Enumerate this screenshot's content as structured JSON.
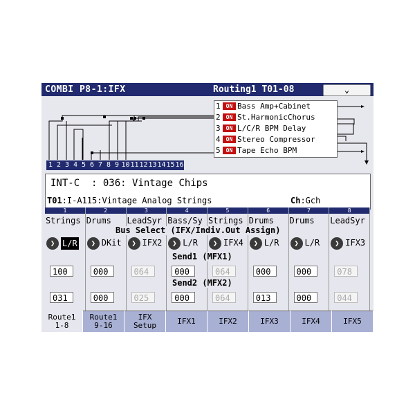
{
  "header": {
    "title": "COMBI P8-1:IFX",
    "subtitle": "Routing1 T01-08",
    "menu_icon": "chevron-down-icon",
    "menu_glyph": "⌄"
  },
  "routing": {
    "ifx": [
      {
        "num": "1",
        "state": "ON",
        "name": "Bass Amp+Cabinet"
      },
      {
        "num": "2",
        "state": "ON",
        "name": "St.HarmonicChorus"
      },
      {
        "num": "3",
        "state": "ON",
        "name": "L/C/R BPM Delay"
      },
      {
        "num": "4",
        "state": "ON",
        "name": "Stereo Compressor"
      },
      {
        "num": "5",
        "state": "ON",
        "name": "Tape Echo BPM"
      }
    ],
    "track_numbers": [
      "1",
      "2",
      "3",
      "4",
      "5",
      "6",
      "7",
      "8",
      "9",
      "10",
      "11",
      "12",
      "13",
      "14",
      "15",
      "16"
    ]
  },
  "program": {
    "bank": "INT-C",
    "name": ": 036: Vintage Chips",
    "timbre_label": "T01",
    "timbre_program": ":I-A115:Vintage Analog Strings",
    "ch_label": "Ch",
    "ch_value": ":Gch"
  },
  "timbres": [
    {
      "num": "1",
      "name": "Strings",
      "bus": "L/R",
      "send1": "100",
      "send2": "031",
      "s1_dim": false,
      "s2_dim": false,
      "selected": true
    },
    {
      "num": "2",
      "name": "Drums",
      "bus": "DKit",
      "send1": "000",
      "send2": "000",
      "s1_dim": false,
      "s2_dim": false,
      "selected": false
    },
    {
      "num": "3",
      "name": "LeadSyr",
      "bus": "IFX2",
      "send1": "064",
      "send2": "025",
      "s1_dim": true,
      "s2_dim": true,
      "selected": false
    },
    {
      "num": "4",
      "name": "Bass/Sy",
      "bus": "L/R",
      "send1": "000",
      "send2": "000",
      "s1_dim": false,
      "s2_dim": false,
      "selected": false
    },
    {
      "num": "5",
      "name": "Strings",
      "bus": "IFX4",
      "send1": "064",
      "send2": "064",
      "s1_dim": true,
      "s2_dim": true,
      "selected": false
    },
    {
      "num": "6",
      "name": "Drums",
      "bus": "L/R",
      "send1": "000",
      "send2": "013",
      "s1_dim": false,
      "s2_dim": false,
      "selected": false
    },
    {
      "num": "7",
      "name": "Drums",
      "bus": "L/R",
      "send1": "000",
      "send2": "000",
      "s1_dim": false,
      "s2_dim": false,
      "selected": false
    },
    {
      "num": "8",
      "name": "LeadSyr",
      "bus": "IFX3",
      "send1": "078",
      "send2": "044",
      "s1_dim": true,
      "s2_dim": true,
      "selected": false
    }
  ],
  "labels": {
    "bus_select": "Bus Select (IFX/Indiv.Out Assign)",
    "send1": "Send1 (MFX1)",
    "send2": "Send2 (MFX2)"
  },
  "tabs": [
    {
      "label": "Route1\n1-8",
      "active": true
    },
    {
      "label": "Route1\n9-16",
      "active": false
    },
    {
      "label": "IFX\nSetup",
      "active": false
    },
    {
      "label": "IFX1",
      "active": false
    },
    {
      "label": "IFX2",
      "active": false
    },
    {
      "label": "IFX3",
      "active": false
    },
    {
      "label": "IFX4",
      "active": false
    },
    {
      "label": "IFX5",
      "active": false
    }
  ],
  "colors": {
    "header": "#212a6e",
    "on_badge": "#c21010",
    "tab": "#a8b0d4",
    "background": "#e6e6ee"
  }
}
